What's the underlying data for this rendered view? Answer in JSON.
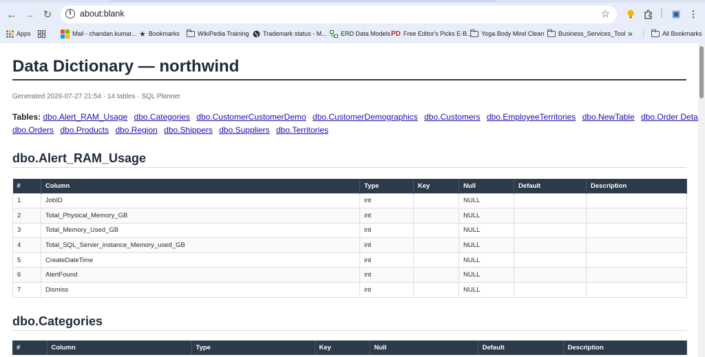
{
  "browser": {
    "url": "about:blank",
    "bookmarks": [
      {
        "label": "Apps",
        "icon": "apps-grid-icon"
      },
      {
        "label": "",
        "icon": "tab-groups-icon"
      },
      {
        "label": "Mail - chandan.kumar...",
        "icon": "microsoft-icon"
      },
      {
        "label": "Bookmarks",
        "icon": "star-icon"
      },
      {
        "label": "WikiPedia Training",
        "icon": "folder-icon"
      },
      {
        "label": "Trademark status - M...",
        "icon": "globe-icon"
      },
      {
        "label": "ERD Data Models",
        "icon": "erd-icon"
      },
      {
        "label": "Free Editor's Picks E-B...",
        "icon": "pdf-icon"
      },
      {
        "label": "Yoga Body Mind Clean",
        "icon": "folder-icon"
      },
      {
        "label": "Business_Services_Tool",
        "icon": "folder-icon"
      }
    ],
    "overflow_label": "»",
    "all_bookmarks_label": "All Bookmarks"
  },
  "page": {
    "title": "Data Dictionary — northwind",
    "meta": "Generated 2026-07-27 21:54 · 14 tables · SQL Planner",
    "tables_label": "Tables:",
    "table_links_row1": [
      "dbo.Alert_RAM_Usage",
      "dbo.Categories",
      "dbo.CustomerCustomerDemo",
      "dbo.CustomerDemographics",
      "dbo.Customers",
      "dbo.EmployeeTerritories",
      "dbo.NewTable",
      "dbo.Order Details"
    ],
    "table_links_row2": [
      "dbo.Orders",
      "dbo.Products",
      "dbo.Region",
      "dbo.Shippers",
      "dbo.Suppliers",
      "dbo.Territories"
    ]
  },
  "sections": [
    {
      "title": "dbo.Alert_RAM_Usage",
      "headers": [
        "#",
        "Column",
        "Type",
        "Key",
        "Null",
        "Default",
        "Description"
      ],
      "rows": [
        [
          "1",
          "JobID",
          "int",
          "",
          "NULL",
          "",
          ""
        ],
        [
          "2",
          "Total_Physical_Memory_GB",
          "int",
          "",
          "NULL",
          "",
          ""
        ],
        [
          "3",
          "Total_Memory_Used_GB",
          "int",
          "",
          "NULL",
          "",
          ""
        ],
        [
          "4",
          "Total_SQL_Server_instance_Memory_used_GB",
          "int",
          "",
          "NULL",
          "",
          ""
        ],
        [
          "5",
          "CreateDateTime",
          "int",
          "",
          "NULL",
          "",
          ""
        ],
        [
          "6",
          "AlertFound",
          "int",
          "",
          "NULL",
          "",
          ""
        ],
        [
          "7",
          "Dismiss",
          "int",
          "",
          "NULL",
          "",
          ""
        ]
      ]
    },
    {
      "title": "dbo.Categories",
      "headers": [
        "#",
        "Column",
        "Type",
        "Key",
        "Null",
        "Default",
        "Description"
      ],
      "rows": []
    }
  ]
}
